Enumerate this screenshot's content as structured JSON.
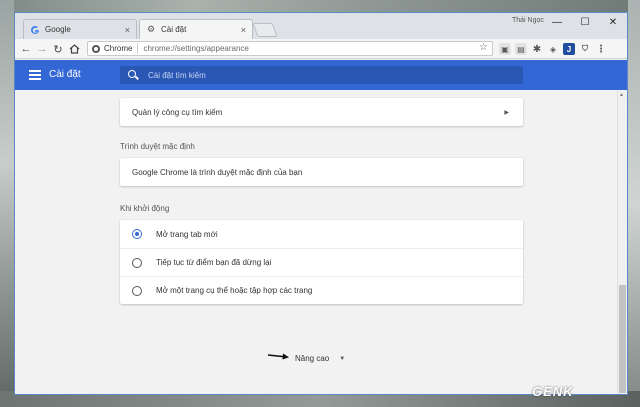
{
  "tabs": [
    {
      "title": "Google"
    },
    {
      "title": "Cài đặt"
    }
  ],
  "user": {
    "name": "Thái Ngọc"
  },
  "window_controls": {
    "minimize": "—",
    "maximize": "☐",
    "close": "✕"
  },
  "omnibox": {
    "secure_label": "Chrome",
    "url": "chrome://settings/appearance"
  },
  "settings_header": {
    "title": "Cài đặt",
    "search_placeholder": "Cài đặt tìm kiếm"
  },
  "search_engines": {
    "manage_label": "Quản lý công cụ tìm kiếm"
  },
  "default_browser": {
    "section_title": "Trình duyệt mặc định",
    "status": "Google Chrome là trình duyệt mặc định của bạn"
  },
  "on_startup": {
    "section_title": "Khi khởi động",
    "options": [
      {
        "label": "Mở trang tab mới",
        "selected": true
      },
      {
        "label": "Tiếp tục từ điểm bạn đã dừng lại",
        "selected": false
      },
      {
        "label": "Mở một trang cụ thể hoặc tập hợp các trang",
        "selected": false
      }
    ]
  },
  "advanced": {
    "label": "Nâng cao"
  },
  "watermark": "GENK",
  "colors": {
    "header_blue": "#3367d6",
    "radio_selected": "#3367d6"
  }
}
